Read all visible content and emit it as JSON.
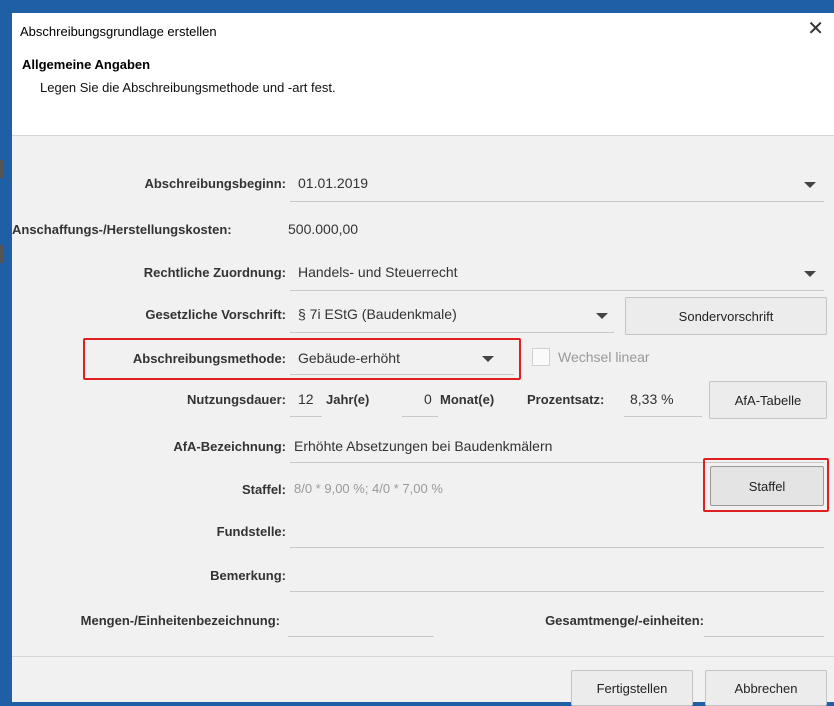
{
  "window": {
    "title": "Abschreibungsgrundlage erstellen",
    "close_glyph": "✕"
  },
  "header": {
    "title": "Allgemeine Angaben",
    "subtitle": "Legen Sie die Abschreibungsmethode und -art fest."
  },
  "form": {
    "beginn_label": "Abschreibungsbeginn:",
    "beginn_value": "01.01.2019",
    "kosten_label": "Anschaffungs-/Herstellungskosten:",
    "kosten_value": "500.000,00",
    "zuordnung_label": "Rechtliche Zuordnung:",
    "zuordnung_value": "Handels- und Steuerrecht",
    "vorschrift_label": "Gesetzliche Vorschrift:",
    "vorschrift_value": "§ 7i EStG (Baudenkmale)",
    "sondervorschrift_button": "Sondervorschrift",
    "methode_label": "Abschreibungsmethode:",
    "methode_value": "Gebäude-erhöht",
    "wechsel_label": "Wechsel linear",
    "nutzungsdauer_label": "Nutzungsdauer:",
    "jahre_value": "12",
    "jahre_unit": "Jahr(e)",
    "monate_value": "0",
    "monate_unit": "Monat(e)",
    "prozentsatz_label": "Prozentsatz:",
    "prozentsatz_value": "8,33 %",
    "afa_tabelle_button": "AfA-Tabelle",
    "bezeichnung_label": "AfA-Bezeichnung:",
    "bezeichnung_value": "Erhöhte Absetzungen bei Baudenkmälern",
    "staffel_label": "Staffel:",
    "staffel_value": "8/0 * 9,00 %; 4/0 * 7,00 %",
    "staffel_button": "Staffel",
    "fundstelle_label": "Fundstelle:",
    "fundstelle_value": "",
    "bemerkung_label": "Bemerkung:",
    "bemerkung_value": "",
    "mengen_label": "Mengen-/Einheitenbezeichnung:",
    "mengen_value": "",
    "gesamt_label": "Gesamtmenge/-einheiten:",
    "gesamt_value": ""
  },
  "footer": {
    "finish_button": "Fertigstellen",
    "cancel_button": "Abbrechen"
  },
  "colors": {
    "highlight": "#e02020",
    "window_border": "#1e5fa6"
  }
}
